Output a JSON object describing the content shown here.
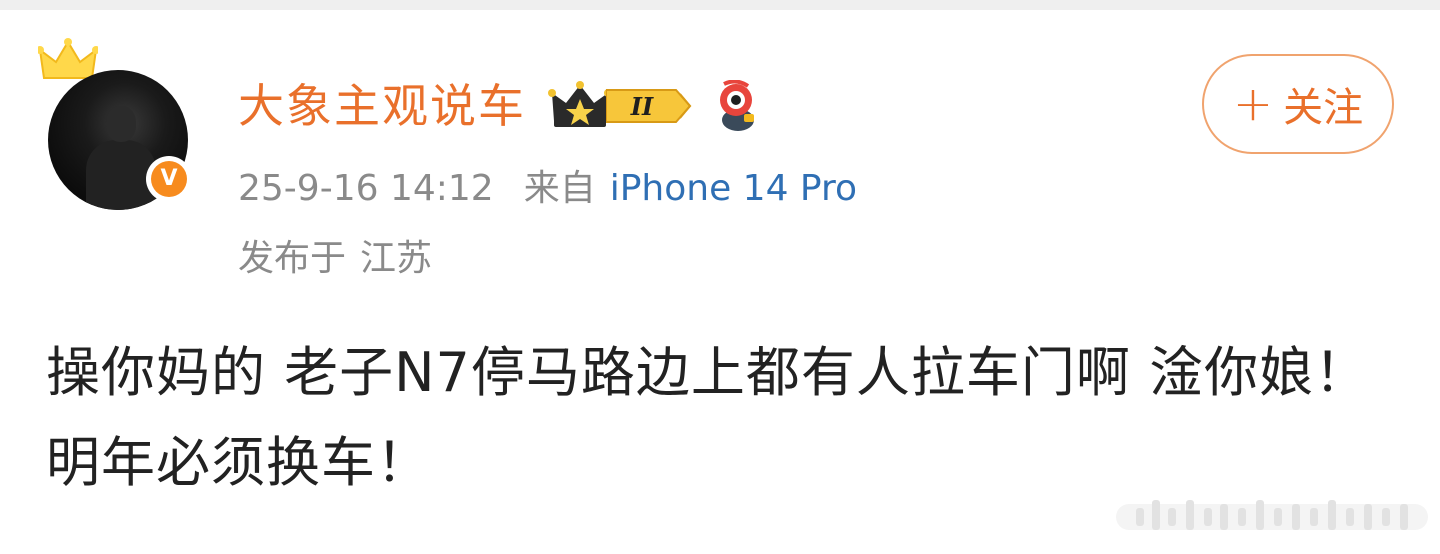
{
  "post": {
    "username": "大象主观说车",
    "timestamp": "25-9-16 14:12",
    "source_label": "来自",
    "device": "iPhone 14 Pro",
    "location_label": "发布于",
    "location": "江苏",
    "text": "操你妈的 老子N7停马路边上都有人拉车门啊 淦你娘！明年必须换车！"
  },
  "follow_button": {
    "plus": "+",
    "label": "关注"
  },
  "badges": {
    "level": "II",
    "verified": "V"
  },
  "icons": {
    "avatar_decoration": "crown-icon",
    "verified": "verified-v-icon",
    "level": "crown-level-icon",
    "mascot": "weibo-mascot-icon",
    "watermark": "watermark-icon"
  },
  "colors": {
    "username": "#e9702b",
    "device_link": "#2f6fb4",
    "meta_text": "#8a8a8a",
    "follow_border": "#f0a36e",
    "verified_badge": "#f78b1e",
    "post_text": "#222222"
  }
}
